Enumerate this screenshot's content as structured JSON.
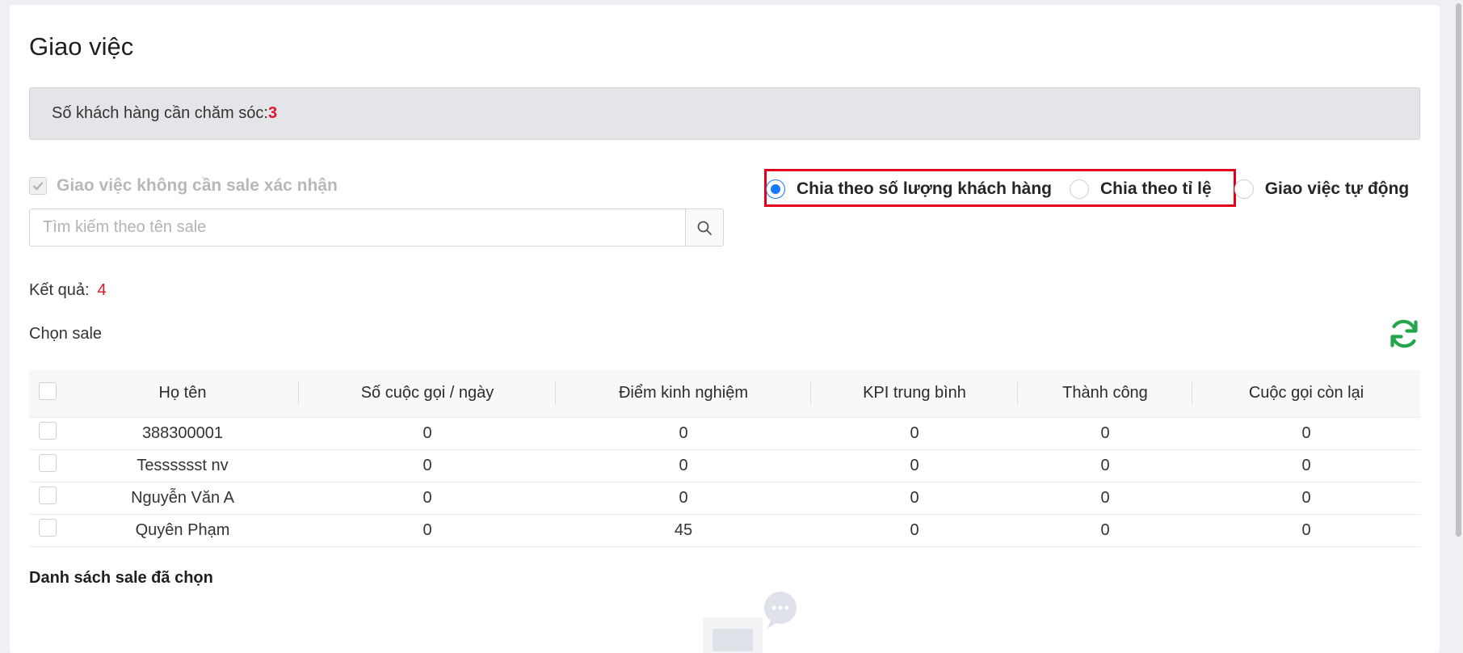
{
  "page": {
    "title": "Giao việc"
  },
  "info": {
    "label": "Số khách hàng cần chăm sóc:",
    "count": "3"
  },
  "options": {
    "no_confirm_label": "Giao việc không cần sale xác nhận",
    "no_confirm_checked": true,
    "distribution": [
      {
        "label": "Chia theo số lượng khách hàng",
        "checked": true
      },
      {
        "label": "Chia theo tỉ lệ",
        "checked": false
      },
      {
        "label": "Giao việc tự động",
        "checked": false
      }
    ]
  },
  "search": {
    "placeholder": "Tìm kiếm theo tên sale",
    "value": ""
  },
  "results": {
    "label": "Kết quả:",
    "count": "4"
  },
  "choose_sale": {
    "label": "Chọn sale"
  },
  "table": {
    "headers": [
      "Họ tên",
      "Số cuộc gọi / ngày",
      "Điểm kinh nghiệm",
      "KPI trung bình",
      "Thành công",
      "Cuộc gọi còn lại"
    ],
    "rows": [
      [
        "388300001",
        "0",
        "0",
        "0",
        "0",
        "0"
      ],
      [
        "Tesssssst nv",
        "0",
        "0",
        "0",
        "0",
        "0"
      ],
      [
        "Nguyễn Văn A",
        "0",
        "0",
        "0",
        "0",
        "0"
      ],
      [
        "Quyên Phạm",
        "0",
        "45",
        "0",
        "0",
        "0"
      ]
    ]
  },
  "selected": {
    "title": "Danh sách sale đã chọn"
  },
  "colors": {
    "accent_blue": "#1677ff",
    "count_red": "#e0162b",
    "highlight_red": "#e3001b",
    "refresh_green": "#21a64b"
  },
  "icons": {
    "search": "search-icon",
    "refresh": "refresh-icon",
    "check": "check-icon",
    "empty": "empty-state-icon"
  }
}
